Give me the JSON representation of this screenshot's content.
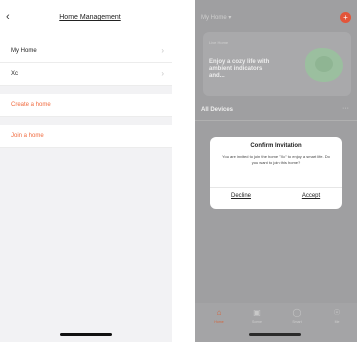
{
  "left": {
    "title": "Home Management",
    "back_icon": "chevron-left-icon",
    "homes": [
      {
        "label": "My Home"
      },
      {
        "label": "Xc"
      }
    ],
    "actions": {
      "create": "Create a home",
      "join": "Join a home"
    },
    "accent_color": "#f06a3e"
  },
  "right": {
    "home_selector": "My Home ▾",
    "add_icon": "plus-icon",
    "weather_card": {
      "location": "Live Home",
      "promo": "Enjoy a cozy life with ambient indicators and..."
    },
    "devices": {
      "title": "All Devices",
      "more": "···"
    },
    "dialog": {
      "title": "Confirm Invitation",
      "message": "You are invited to join the home \"Xc\" to enjoy a smart life. Do you want to join this home?",
      "decline": "Decline",
      "accept": "Accept"
    },
    "tabs": [
      {
        "label": "Home",
        "icon": "home-icon",
        "active": true
      },
      {
        "label": "Scene",
        "icon": "scene-icon",
        "active": false
      },
      {
        "label": "Smart",
        "icon": "smart-icon",
        "active": false
      },
      {
        "label": "Me",
        "icon": "me-icon",
        "active": false
      }
    ],
    "accent_color": "#e3553a"
  }
}
